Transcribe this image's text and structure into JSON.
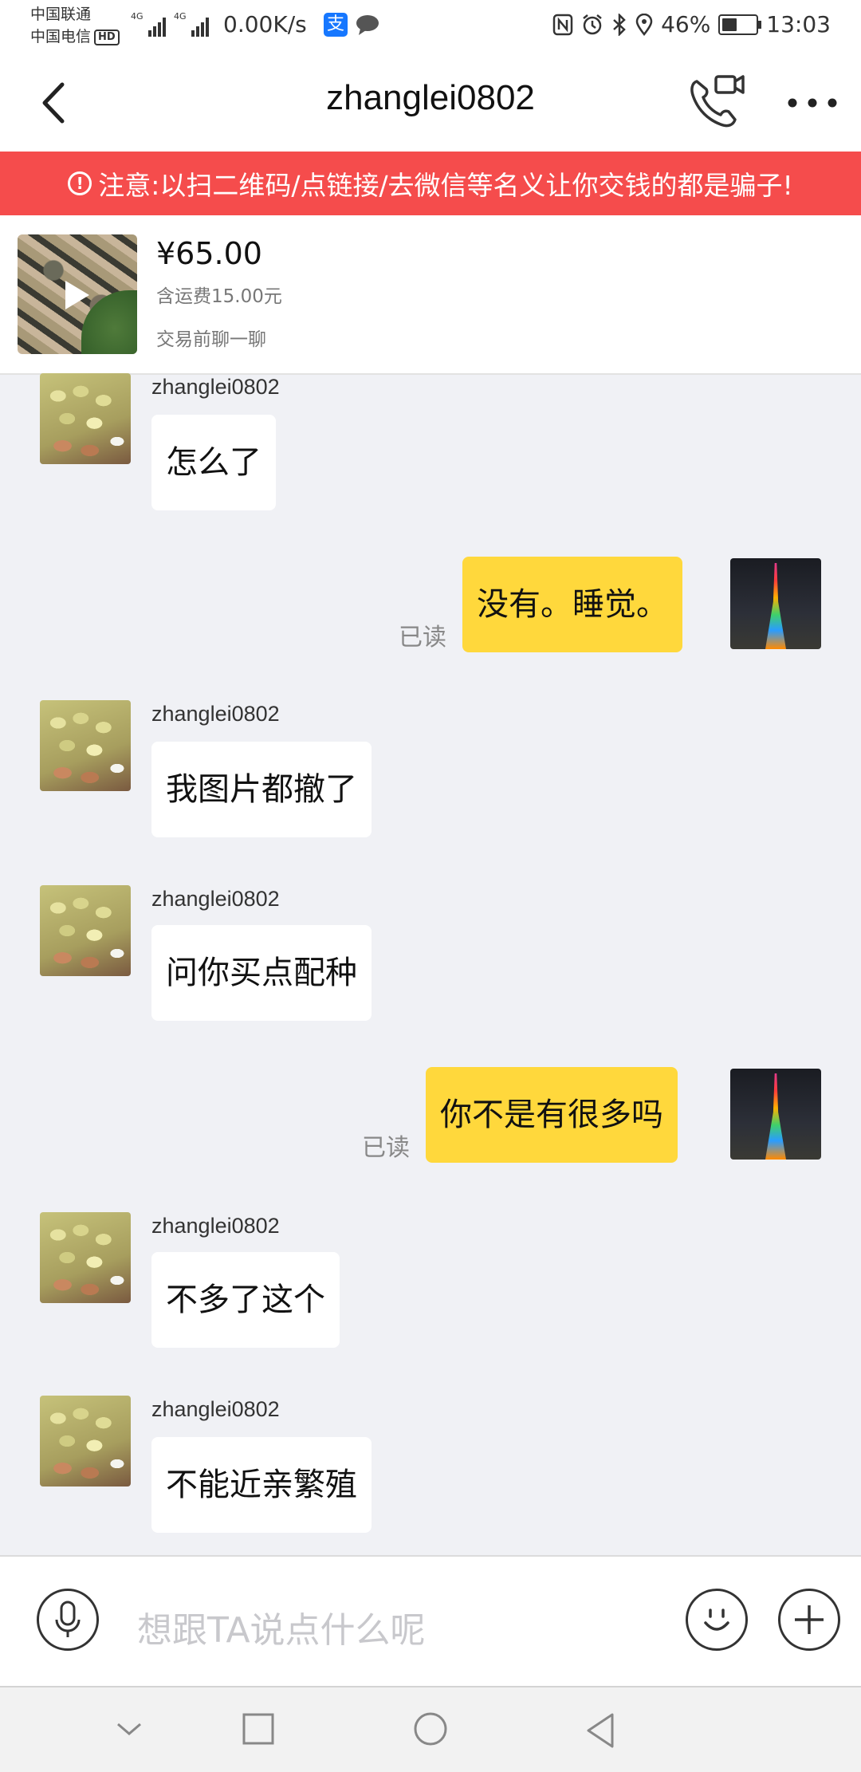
{
  "status_bar": {
    "carrier_1": "中国联通",
    "carrier_2": "中国电信",
    "hd": "HD",
    "network_1": "4G",
    "network_2": "4G",
    "speed": "0.00K/s",
    "alipay_glyph": "支",
    "battery_level": 0.46,
    "battery": "46%",
    "time": "13:03",
    "icons": [
      "nfc-icon",
      "alarm-icon",
      "bluetooth-icon",
      "location-icon",
      "battery-icon"
    ]
  },
  "header": {
    "title": "zhanglei0802"
  },
  "warning": {
    "text": "注意:以扫二维码/点链接/去微信等名义让你交钱的都是骗子!"
  },
  "product": {
    "price": "¥65.00",
    "shipping": "含运费15.00元",
    "status": "交易前聊一聊"
  },
  "messages": [
    {
      "from": "other",
      "sender": "zhanglei0802",
      "text": "怎么了"
    },
    {
      "from": "self",
      "text": "没有。睡觉。",
      "read": "已读"
    },
    {
      "from": "other",
      "sender": "zhanglei0802",
      "text": "我图片都撤了"
    },
    {
      "from": "other",
      "sender": "zhanglei0802",
      "text": "问你买点配种"
    },
    {
      "from": "self",
      "text": "你不是有很多吗",
      "read": "已读"
    },
    {
      "from": "other",
      "sender": "zhanglei0802",
      "text": "不多了这个"
    },
    {
      "from": "other",
      "sender": "zhanglei0802",
      "text": "不能近亲繁殖"
    }
  ],
  "input": {
    "placeholder": "想跟TA说点什么呢"
  },
  "colors": {
    "warning_bg": "#f54c4c",
    "self_bubble": "#ffd83c",
    "chat_bg": "#f0f1f5"
  }
}
